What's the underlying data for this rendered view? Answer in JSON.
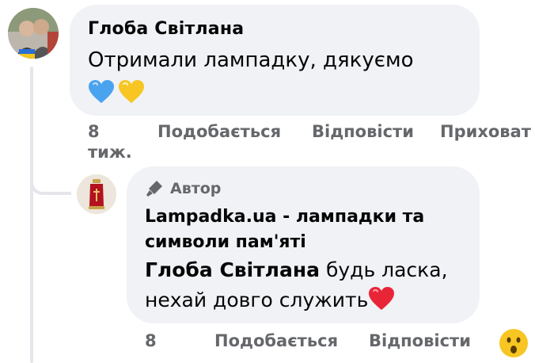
{
  "comments": [
    {
      "author": "Глоба Світлана",
      "text": "Отримали лампадку, дякуємо",
      "emojis": [
        "blue-heart",
        "yellow-heart"
      ],
      "actions": {
        "time": "8",
        "time_unit": "тиж.",
        "like": "Подобається",
        "reply": "Відповісти",
        "hide": "Приховат"
      }
    },
    {
      "badge": "Автор",
      "author": "Lampadka.ua - лампадки та символи пам'яті",
      "mention": "Глоба Світлана",
      "text": " будь ласка, нехай довго служить",
      "emoji": "red-heart",
      "actions": {
        "time": "8",
        "like": "Подобається",
        "reply": "Відповісти"
      },
      "reaction": "surprised-face"
    }
  ],
  "colors": {
    "bubble": "#f0f2f5",
    "secondary_text": "#65676b",
    "thread_line": "#e4e6eb"
  }
}
